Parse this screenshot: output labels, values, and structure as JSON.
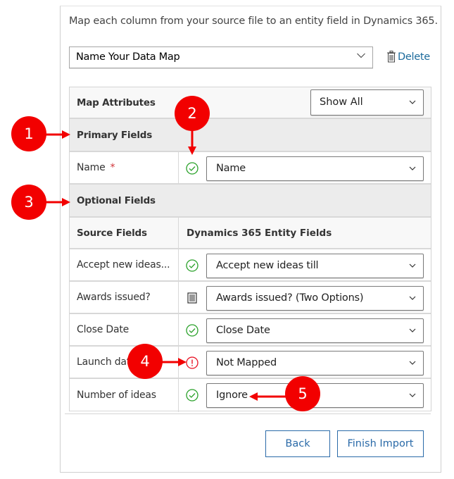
{
  "intro_text": "Map each column from your source file to an entity field in Dynamics 365.",
  "data_map": {
    "selected": "Name Your Data Map",
    "delete_label": "Delete"
  },
  "table": {
    "header_label": "Map Attributes",
    "filter": {
      "selected": "Show All"
    },
    "primary_section_label": "Primary Fields",
    "primary_rows": [
      {
        "source": "Name",
        "required_marker": "*",
        "status": "mapped",
        "target": "Name"
      }
    ],
    "optional_section_label": "Optional Fields",
    "columns": {
      "source": "Source Fields",
      "target": "Dynamics 365 Entity Fields"
    },
    "optional_rows": [
      {
        "source": "Accept new ideas...",
        "status": "mapped",
        "target": "Accept new ideas till"
      },
      {
        "source": "Awards issued?",
        "status": "option-set",
        "target": "Awards issued? (Two Options)"
      },
      {
        "source": "Close Date",
        "status": "mapped",
        "target": "Close Date"
      },
      {
        "source": "Launch date",
        "status": "not-mapped",
        "target": "Not Mapped"
      },
      {
        "source": "Number of ideas",
        "status": "mapped",
        "target": "Ignore"
      }
    ]
  },
  "buttons": {
    "back": "Back",
    "finish": "Finish Import"
  },
  "callouts": [
    "1",
    "2",
    "3",
    "4",
    "5"
  ],
  "colors": {
    "mapped_green": "#2aa12a",
    "error_red": "#e81123",
    "callout_red": "#f20000",
    "link_blue": "#1c6b9c",
    "button_blue": "#2a6aa8"
  }
}
